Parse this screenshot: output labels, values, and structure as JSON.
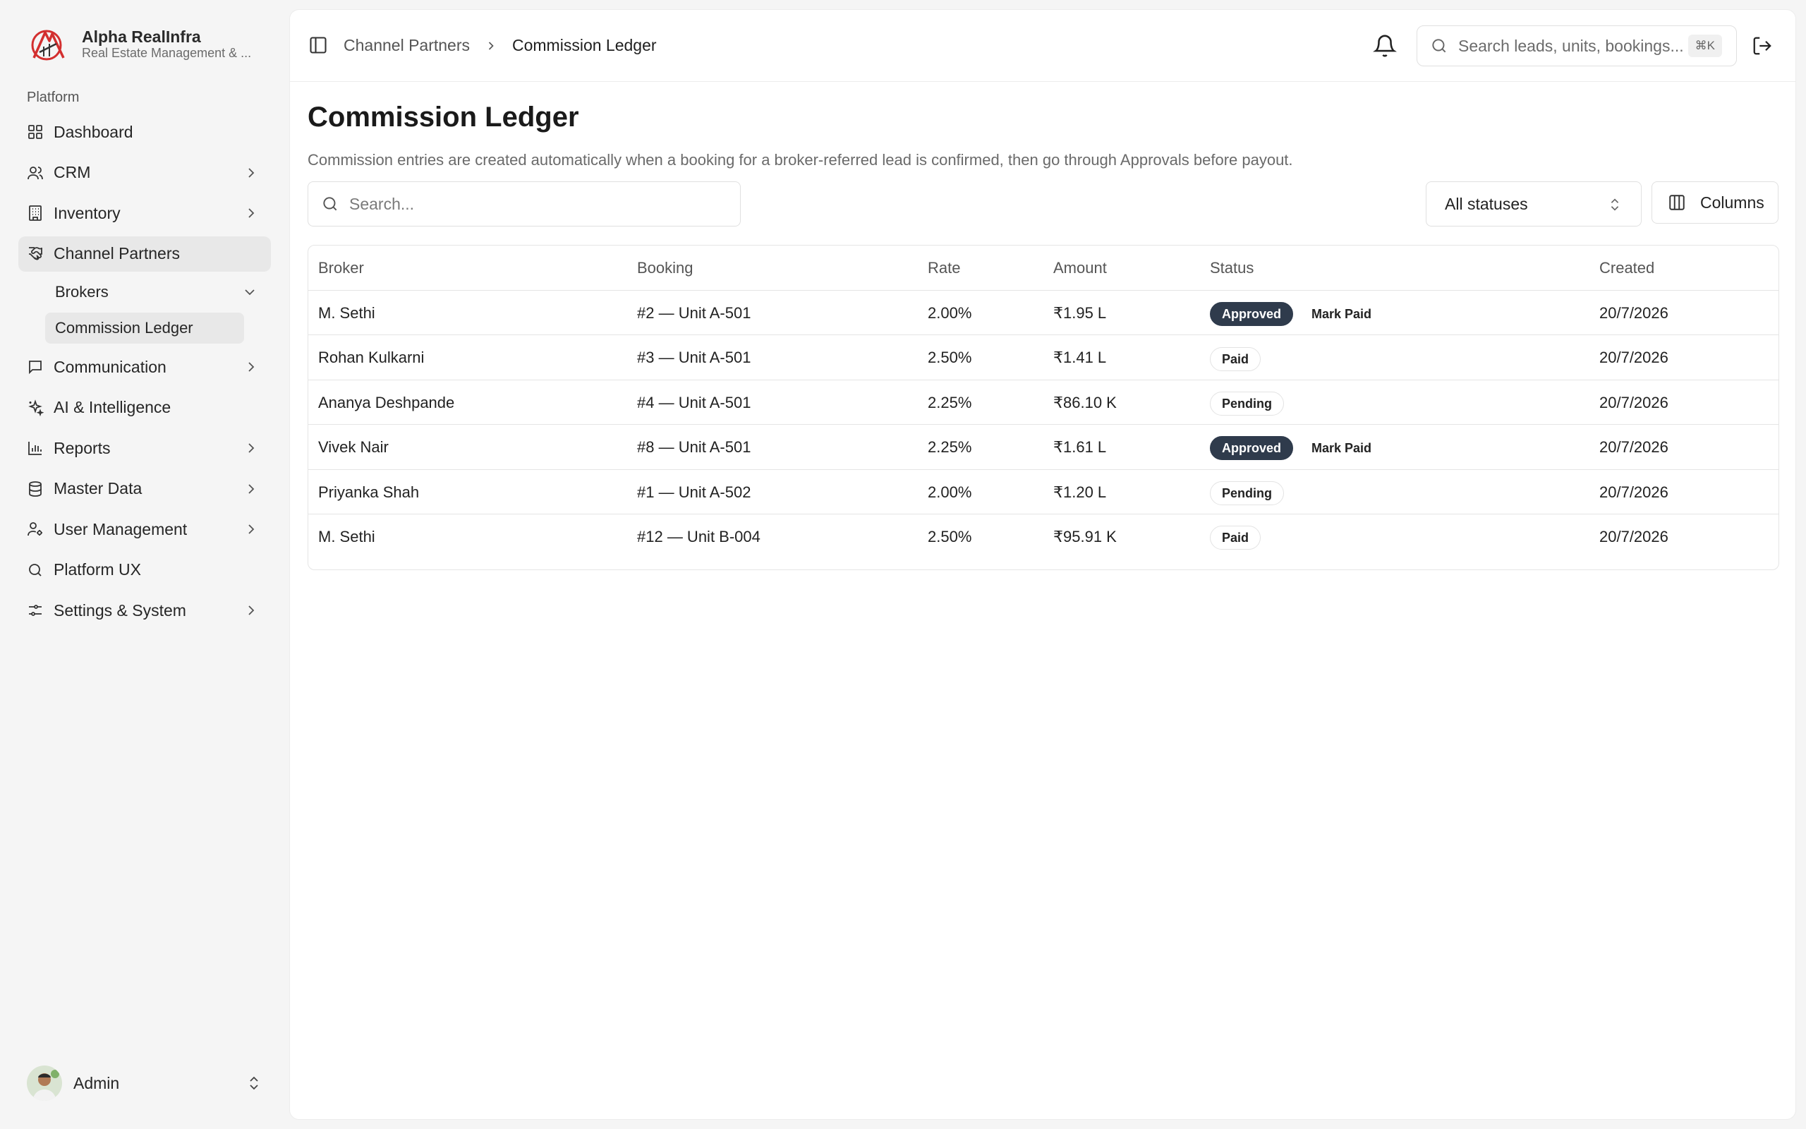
{
  "brand": {
    "name": "Alpha RealInfra",
    "subtitle": "Real Estate Management & ..."
  },
  "sidebar": {
    "group_label": "Platform",
    "items": [
      {
        "label": "Dashboard",
        "icon": "grid-icon",
        "chevron": false
      },
      {
        "label": "CRM",
        "icon": "users-icon",
        "chevron": true
      },
      {
        "label": "Inventory",
        "icon": "building-icon",
        "chevron": true
      },
      {
        "label": "Channel Partners",
        "icon": "handshake-icon",
        "chevron": false,
        "active": true
      },
      {
        "label": "Communication",
        "icon": "message-icon",
        "chevron": true
      },
      {
        "label": "AI & Intelligence",
        "icon": "sparkles-icon",
        "chevron": false
      },
      {
        "label": "Reports",
        "icon": "bar-chart-icon",
        "chevron": true
      },
      {
        "label": "Master Data",
        "icon": "database-icon",
        "chevron": true
      },
      {
        "label": "User Management",
        "icon": "user-cog-icon",
        "chevron": true
      },
      {
        "label": "Platform UX",
        "icon": "search-icon",
        "chevron": false
      },
      {
        "label": "Settings & System",
        "icon": "sliders-icon",
        "chevron": true
      }
    ],
    "subitems": [
      {
        "label": "Brokers"
      },
      {
        "label": "Commission Ledger",
        "active": true
      }
    ],
    "user": {
      "name": "Admin"
    }
  },
  "topbar": {
    "breadcrumb_parent": "Channel Partners",
    "breadcrumb_current": "Commission Ledger",
    "search_placeholder": "Search leads, units, bookings...",
    "shortcut": "⌘K"
  },
  "page": {
    "title": "Commission Ledger",
    "description": "Commission entries are created automatically when a booking for a broker-referred lead is confirmed, then go through Approvals before payout.",
    "search_placeholder": "Search...",
    "status_filter": "All statuses",
    "columns_button": "Columns"
  },
  "table": {
    "headers": {
      "broker": "Broker",
      "booking": "Booking",
      "rate": "Rate",
      "amount": "Amount",
      "status": "Status",
      "created": "Created"
    },
    "action_label": "Mark Paid",
    "rows": [
      {
        "broker": "M. Sethi",
        "booking": "#2 — Unit A-501",
        "rate": "2.00%",
        "amount": "₹1.95 L",
        "status": "Approved",
        "created": "20/7/2026"
      },
      {
        "broker": "Rohan Kulkarni",
        "booking": "#3 — Unit A-501",
        "rate": "2.50%",
        "amount": "₹1.41 L",
        "status": "Paid",
        "created": "20/7/2026"
      },
      {
        "broker": "Ananya Deshpande",
        "booking": "#4 — Unit A-501",
        "rate": "2.25%",
        "amount": "₹86.10 K",
        "status": "Pending",
        "created": "20/7/2026"
      },
      {
        "broker": "Vivek Nair",
        "booking": "#8 — Unit A-501",
        "rate": "2.25%",
        "amount": "₹1.61 L",
        "status": "Approved",
        "created": "20/7/2026"
      },
      {
        "broker": "Priyanka Shah",
        "booking": "#1 — Unit A-502",
        "rate": "2.00%",
        "amount": "₹1.20 L",
        "status": "Pending",
        "created": "20/7/2026"
      },
      {
        "broker": "M. Sethi",
        "booking": "#12 — Unit B-004",
        "rate": "2.50%",
        "amount": "₹95.91 K",
        "status": "Paid",
        "created": "20/7/2026"
      }
    ]
  },
  "colors": {
    "accent_logo": "#d32f2f",
    "badge_approved": "#2f3b4c",
    "active_bg": "#e8e8e8"
  }
}
